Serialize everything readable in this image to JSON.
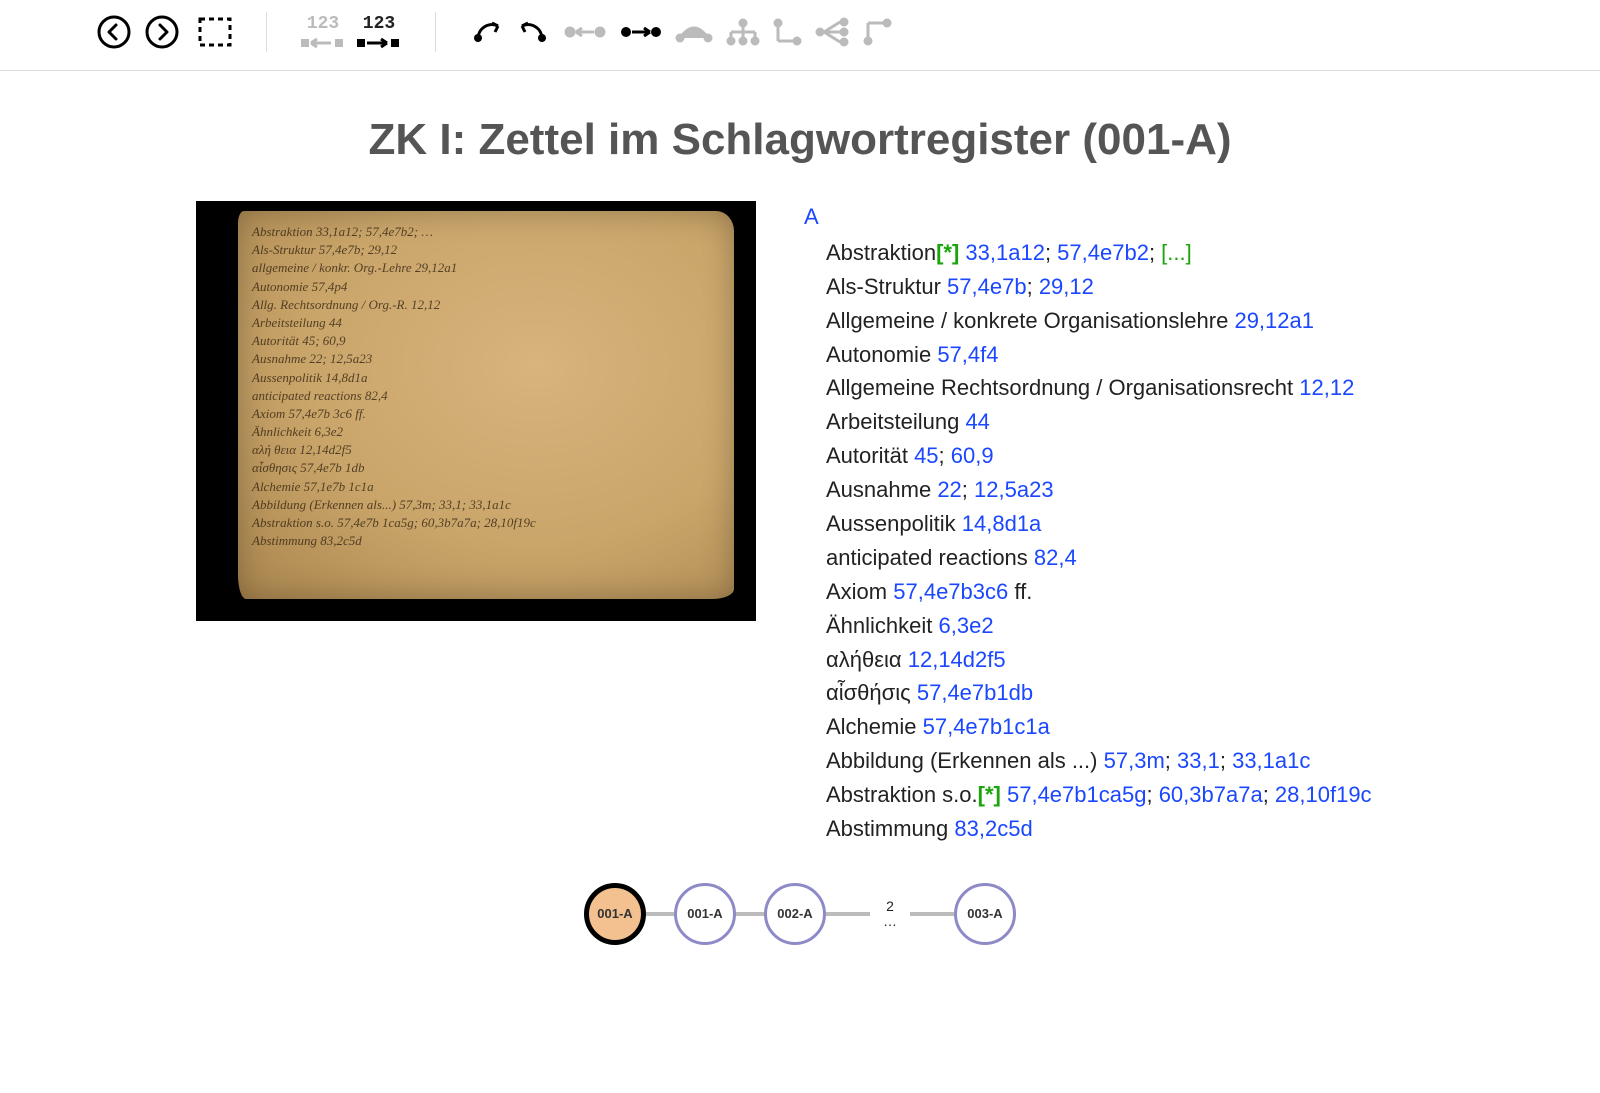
{
  "toolbar": {
    "prev": "previous",
    "next": "next",
    "select_area": "select-area",
    "mode_numbered_dim": "123",
    "mode_numbered": "123"
  },
  "title": "ZK I: Zettel im Schlagwortregister (001-A)",
  "letter": "A",
  "entries": [
    {
      "term": "Abstraktion",
      "star": "[*]",
      "refs": [
        "33,1a12",
        "57,4e7b2"
      ],
      "ellipsis": "[...]"
    },
    {
      "term": "Als-Struktur",
      "refs": [
        "57,4e7b",
        "29,12"
      ]
    },
    {
      "term": "Allgemeine / konkrete Organisationslehre",
      "refs": [
        "29,12a1"
      ]
    },
    {
      "term": "Autonomie",
      "refs": [
        "57,4f4"
      ]
    },
    {
      "term": "Allgemeine Rechtsordnung / Organisationsrecht",
      "refs": [
        "12,12"
      ]
    },
    {
      "term": "Arbeitsteilung",
      "refs": [
        "44"
      ]
    },
    {
      "term": "Autorität",
      "refs": [
        "45",
        "60,9"
      ]
    },
    {
      "term": "Ausnahme",
      "refs": [
        "22",
        "12,5a23"
      ]
    },
    {
      "term": "Aussenpolitik",
      "refs": [
        "14,8d1a"
      ]
    },
    {
      "term": "anticipated reactions",
      "refs": [
        "82,4"
      ]
    },
    {
      "term": "Axiom",
      "refs": [
        "57,4e7b3c6"
      ],
      "suffix": " ff."
    },
    {
      "term": "Ähnlichkeit",
      "refs": [
        "6,3e2"
      ]
    },
    {
      "term": "αλήθεια",
      "refs": [
        "12,14d2f5"
      ]
    },
    {
      "term": "αἶσθήσις",
      "refs": [
        "57,4e7b1db"
      ]
    },
    {
      "term": "Alchemie",
      "refs": [
        "57,4e7b1c1a"
      ]
    },
    {
      "term": "Abbildung (Erkennen als ...)",
      "refs": [
        "57,3m",
        "33,1",
        "33,1a1c"
      ]
    },
    {
      "term": "Abstraktion s.o.",
      "star": "[*]",
      "refs": [
        "57,4e7b1ca5g",
        "60,3b7a7a",
        "28,10f19c"
      ]
    },
    {
      "term": "Abstimmung",
      "refs": [
        "83,2c5d"
      ]
    }
  ],
  "scan_lines": [
    "Abstraktion 33,1a12; 57,4e7b2; …",
    "Als-Struktur 57,4e7b; 29,12",
    "allgemeine / konkr. Org.-Lehre 29,12a1",
    "Autonomie 57,4p4",
    "Allg. Rechtsordnung / Org.-R. 12,12",
    "Arbeitsteilung 44",
    "Autorität 45; 60,9",
    "Ausnahme 22; 12,5a23",
    "Aussenpolitik 14,8d1a",
    "anticipated reactions 82,4",
    "Axiom 57,4e7b 3c6 ff.",
    "Ähnlichkeit 6,3e2",
    "αλή θεια 12,14d2f5",
    "αἶσθησις 57,4e7b 1db",
    "Alchemie 57,1e7b 1c1a",
    "Abbildung (Erkennen als...) 57,3m; 33,1; 33,1a1c",
    "Abstraktion s.o. 57,4e7b 1ca5g; 60,3b7a7a; 28,10f19c",
    "Abstimmung 83,2c5d"
  ],
  "nav": {
    "nodes": [
      "001-A",
      "001-A",
      "002-A",
      "003-A"
    ],
    "gap_count": "2",
    "gap_ellipsis": "…"
  },
  "colors": {
    "link": "#1a47ff",
    "star": "#1aa50a",
    "node_border": "#8e8ac7",
    "current_fill": "#f3c08f"
  }
}
